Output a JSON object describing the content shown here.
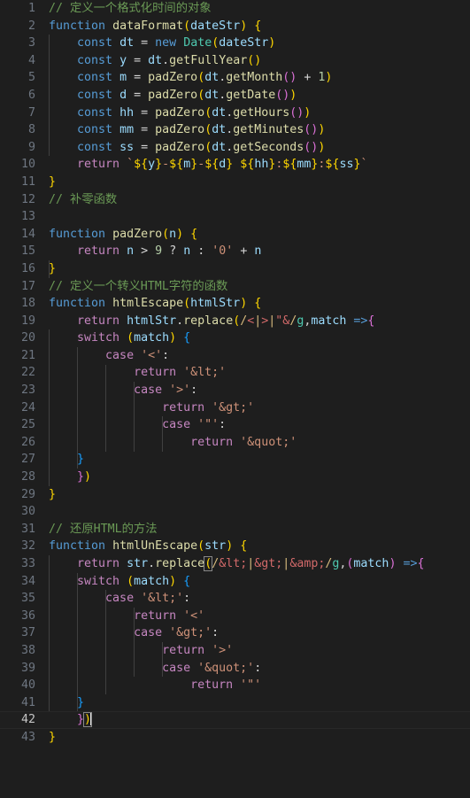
{
  "editor": {
    "language": "javascript",
    "theme": "Dark+ (default dark)",
    "background_color": "#1e1e1e",
    "line_number_color": "#6e7681",
    "active_line_number_color": "#c6c6c6",
    "active_line": 42,
    "cursor_line": 42,
    "cursor_column": 7,
    "first_visible_line": 1,
    "last_visible_line": 43,
    "colors": {
      "comment": "#6a9955",
      "keyword": "#569cd6",
      "control": "#c586c0",
      "function": "#dcdcaa",
      "variable": "#9cdcfe",
      "class": "#4ec9b0",
      "string": "#ce9178",
      "number": "#b5cea8",
      "operator": "#d4d4d4",
      "regex": "#d16969",
      "regex_delimiter": "#d7ba7d",
      "indent_guide": "#404040",
      "active_line_background": "#1f1f1f",
      "cursor": "#e8e8e8"
    }
  },
  "lines": [
    {
      "n": 1,
      "text": "// 定义一个格式化时间的对象"
    },
    {
      "n": 2,
      "text": "function dataFormat(dateStr) {"
    },
    {
      "n": 3,
      "text": "    const dt = new Date(dateStr)"
    },
    {
      "n": 4,
      "text": "    const y = dt.getFullYear()"
    },
    {
      "n": 5,
      "text": "    const m = padZero(dt.getMonth() + 1)"
    },
    {
      "n": 6,
      "text": "    const d = padZero(dt.getDate())"
    },
    {
      "n": 7,
      "text": "    const hh = padZero(dt.getHours())"
    },
    {
      "n": 8,
      "text": "    const mm = padZero(dt.getMinutes())"
    },
    {
      "n": 9,
      "text": "    const ss = padZero(dt.getSeconds())"
    },
    {
      "n": 10,
      "text": "    return `${y}-${m}-${d} ${hh}:${mm}:${ss}`"
    },
    {
      "n": 11,
      "text": "}"
    },
    {
      "n": 12,
      "text": "// 补零函数"
    },
    {
      "n": 13,
      "text": ""
    },
    {
      "n": 14,
      "text": "function padZero(n) {"
    },
    {
      "n": 15,
      "text": "    return n > 9 ? n : '0' + n"
    },
    {
      "n": 16,
      "text": "}"
    },
    {
      "n": 17,
      "text": "// 定义一个转义HTML字符的函数"
    },
    {
      "n": 18,
      "text": "function htmlEscape(htmlStr) {"
    },
    {
      "n": 19,
      "text": "    return htmlStr.replace(/<|>|\"&/g,match =>{"
    },
    {
      "n": 20,
      "text": "    switch (match) {"
    },
    {
      "n": 21,
      "text": "        case '<':"
    },
    {
      "n": 22,
      "text": "            return '&lt;'"
    },
    {
      "n": 23,
      "text": "            case '>':"
    },
    {
      "n": 24,
      "text": "                return '&gt;'"
    },
    {
      "n": 25,
      "text": "                case '\"':"
    },
    {
      "n": 26,
      "text": "                    return '&quot;'"
    },
    {
      "n": 27,
      "text": "    }"
    },
    {
      "n": 28,
      "text": "    })"
    },
    {
      "n": 29,
      "text": "}"
    },
    {
      "n": 30,
      "text": ""
    },
    {
      "n": 31,
      "text": "// 还原HTML的方法"
    },
    {
      "n": 32,
      "text": "function htmlUnEscape(str) {"
    },
    {
      "n": 33,
      "text": "    return str.replace(/&lt;|&gt;|&amp;/g,(match) =>{"
    },
    {
      "n": 34,
      "text": "    switch (match) {"
    },
    {
      "n": 35,
      "text": "        case '&lt;':"
    },
    {
      "n": 36,
      "text": "            return '<'"
    },
    {
      "n": 37,
      "text": "            case '&gt;':"
    },
    {
      "n": 38,
      "text": "                return '>'"
    },
    {
      "n": 39,
      "text": "                case '&quot;':"
    },
    {
      "n": 40,
      "text": "                    return '\"'"
    },
    {
      "n": 41,
      "text": "    }"
    },
    {
      "n": 42,
      "text": "    })"
    },
    {
      "n": 43,
      "text": "}"
    }
  ],
  "line_numbers": {
    "l1": "1",
    "l2": "2",
    "l3": "3",
    "l4": "4",
    "l5": "5",
    "l6": "6",
    "l7": "7",
    "l8": "8",
    "l9": "9",
    "l10": "10",
    "l11": "11",
    "l12": "12",
    "l13": "13",
    "l14": "14",
    "l15": "15",
    "l16": "16",
    "l17": "17",
    "l18": "18",
    "l19": "19",
    "l20": "20",
    "l21": "21",
    "l22": "22",
    "l23": "23",
    "l24": "24",
    "l25": "25",
    "l26": "26",
    "l27": "27",
    "l28": "28",
    "l29": "29",
    "l30": "30",
    "l31": "31",
    "l32": "32",
    "l33": "33",
    "l34": "34",
    "l35": "35",
    "l36": "36",
    "l37": "37",
    "l38": "38",
    "l39": "39",
    "l40": "40",
    "l41": "41",
    "l42": "42",
    "l43": "43"
  },
  "tokens": {
    "comment_line1": "// 定义一个格式化时间的对象",
    "comment_line12": "// 补零函数",
    "comment_line17": "// 定义一个转义HTML字符的函数",
    "comment_line31": "// 还原HTML的方法",
    "kw_function": "function",
    "kw_const": "const",
    "kw_new": "new",
    "kw_return": "return",
    "kw_switch": "switch",
    "kw_case": "case",
    "fn_dataFormat": "dataFormat",
    "fn_padZero": "padZero",
    "fn_htmlEscape": "htmlEscape",
    "fn_htmlUnEscape": "htmlUnEscape",
    "fn_getFullYear": "getFullYear",
    "fn_getMonth": "getMonth",
    "fn_getDate": "getDate",
    "fn_getHours": "getHours",
    "fn_getMinutes": "getMinutes",
    "fn_getSeconds": "getSeconds",
    "fn_replace": "replace",
    "cls_Date": "Date",
    "var_dateStr": "dateStr",
    "var_dt": "dt",
    "var_y": "y",
    "var_m": "m",
    "var_d": "d",
    "var_hh": "hh",
    "var_mm": "mm",
    "var_ss": "ss",
    "var_n": "n",
    "var_htmlStr": "htmlStr",
    "var_str": "str",
    "var_match": "match",
    "str_zero": "'0'",
    "str_lt_char": "'<'",
    "str_gt_char": "'>'",
    "str_quot_char": "'\"'",
    "str_lt_entity": "'&lt;'",
    "str_gt_entity": "'&gt;'",
    "str_quot_entity": "'&quot;'",
    "regex_escape": "/<|>|\"&/g",
    "regex_unescape": "/&lt;|&gt;|&amp;/g",
    "num_9": "9",
    "num_1": "1",
    "template_literal": "`${y}-${m}-${d} ${hh}:${mm}:${ss}`"
  }
}
